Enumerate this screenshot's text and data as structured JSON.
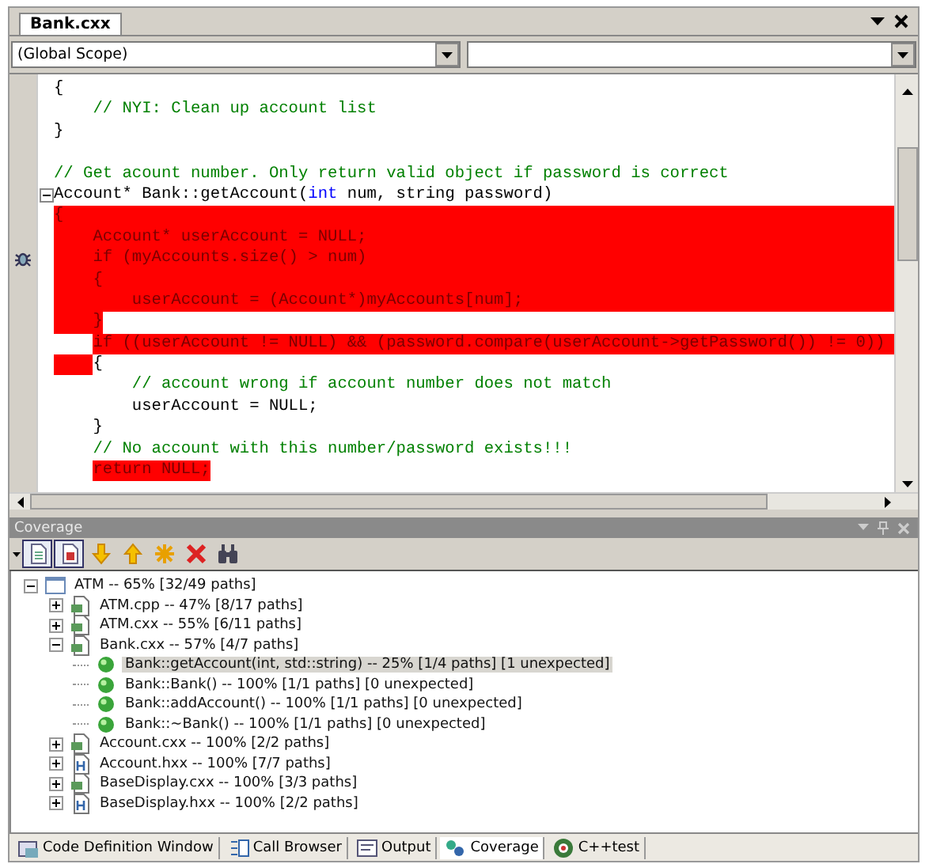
{
  "editor": {
    "tab": {
      "label": "Bank.cxx",
      "selected": true
    },
    "scope_combo": {
      "value": "(Global Scope)"
    },
    "lines": [
      {
        "kind": "plain",
        "text": "{"
      },
      {
        "kind": "plain",
        "text": "    // NYI: Clean up account list",
        "comment": true
      },
      {
        "kind": "plain",
        "text": "}"
      },
      {
        "kind": "plain"
      },
      {
        "kind": "plain",
        "text": "// Get acount number. Only return valid object if password is correct",
        "comment": true
      },
      {
        "kind": "plain",
        "foldable": true,
        "segments": [
          {
            "keyword": false,
            "text": "Account* Bank::getAccount("
          },
          {
            "keyword": true,
            "text": "int"
          },
          {
            "keyword": false,
            "text": " num, string password)"
          }
        ]
      },
      {
        "kind": "full",
        "text": "{"
      },
      {
        "kind": "full",
        "text": "    Account* userAccount = NULL;"
      },
      {
        "kind": "full",
        "marked": true,
        "text": "    if (myAccounts.size() > num)"
      },
      {
        "kind": "full",
        "text": "    {"
      },
      {
        "kind": "full",
        "text": "        userAccount = (Account*)myAccounts[num];"
      },
      {
        "kind": "lead",
        "text": "    }"
      },
      {
        "kind": "rest",
        "text": "    if ((userAccount != NULL) && (password.compare(userAccount->getPassword()) != 0))"
      },
      {
        "kind": "margin",
        "text": "    {"
      },
      {
        "kind": "plain",
        "text": "        // account wrong if account number does not match",
        "comment": true
      },
      {
        "kind": "plain",
        "text": "        userAccount = NULL;"
      },
      {
        "kind": "plain",
        "text": "    }"
      },
      {
        "kind": "plain",
        "text": "    // No account with this number/password exists!!!",
        "comment": true
      },
      {
        "kind": "text",
        "text": "    return NULL;"
      }
    ]
  },
  "coverage": {
    "title": "Coverage",
    "toolbar": [
      {
        "kind": "page",
        "pressed": true
      },
      {
        "kind": "page-red",
        "pressed": true
      },
      {
        "kind": "down",
        "pressed": false
      },
      {
        "kind": "up",
        "pressed": false
      },
      {
        "kind": "star",
        "pressed": false
      },
      {
        "kind": "delete",
        "pressed": false
      },
      {
        "kind": "find",
        "pressed": false
      }
    ],
    "tree": [
      {
        "kind": "project",
        "label": "ATM -- 65% [32/49 paths]",
        "expanded": true,
        "selected": false,
        "children": [
          {
            "kind": "source",
            "label": "ATM.cpp -- 47% [8/17 paths]",
            "expanded": false,
            "selected": false
          },
          {
            "kind": "source",
            "label": "ATM.cxx -- 55% [6/11 paths]",
            "expanded": false,
            "selected": false
          },
          {
            "kind": "source",
            "label": "Bank.cxx -- 57% [4/7 paths]",
            "expanded": true,
            "selected": false,
            "children": [
              {
                "kind": "function",
                "label": "Bank::getAccount(int, std::string) -- 25% [1/4 paths] [1 unexpected]",
                "selected": true
              },
              {
                "kind": "function",
                "label": "Bank::Bank() -- 100% [1/1 paths] [0 unexpected]",
                "selected": false
              },
              {
                "kind": "function",
                "label": "Bank::addAccount() -- 100% [1/1 paths] [0 unexpected]",
                "selected": false
              },
              {
                "kind": "function",
                "label": "Bank::~Bank() -- 100% [1/1 paths] [0 unexpected]",
                "selected": false
              }
            ]
          },
          {
            "kind": "source",
            "label": "Account.cxx -- 100% [2/2 paths]",
            "expanded": false,
            "selected": false
          },
          {
            "kind": "header",
            "label": "Account.hxx -- 100% [7/7 paths]",
            "expanded": false,
            "selected": false
          },
          {
            "kind": "source",
            "label": "BaseDisplay.cxx -- 100% [3/3 paths]",
            "expanded": false,
            "selected": false
          },
          {
            "kind": "header",
            "label": "BaseDisplay.hxx -- 100% [2/2 paths]",
            "expanded": false,
            "selected": false
          }
        ]
      }
    ]
  },
  "bottom_tabs": [
    {
      "label": "Code Definition Window",
      "selected": false
    },
    {
      "label": "Call Browser",
      "selected": false
    },
    {
      "label": "Output",
      "selected": false
    },
    {
      "label": "Coverage",
      "selected": true
    },
    {
      "label": "C++test",
      "selected": false
    }
  ]
}
